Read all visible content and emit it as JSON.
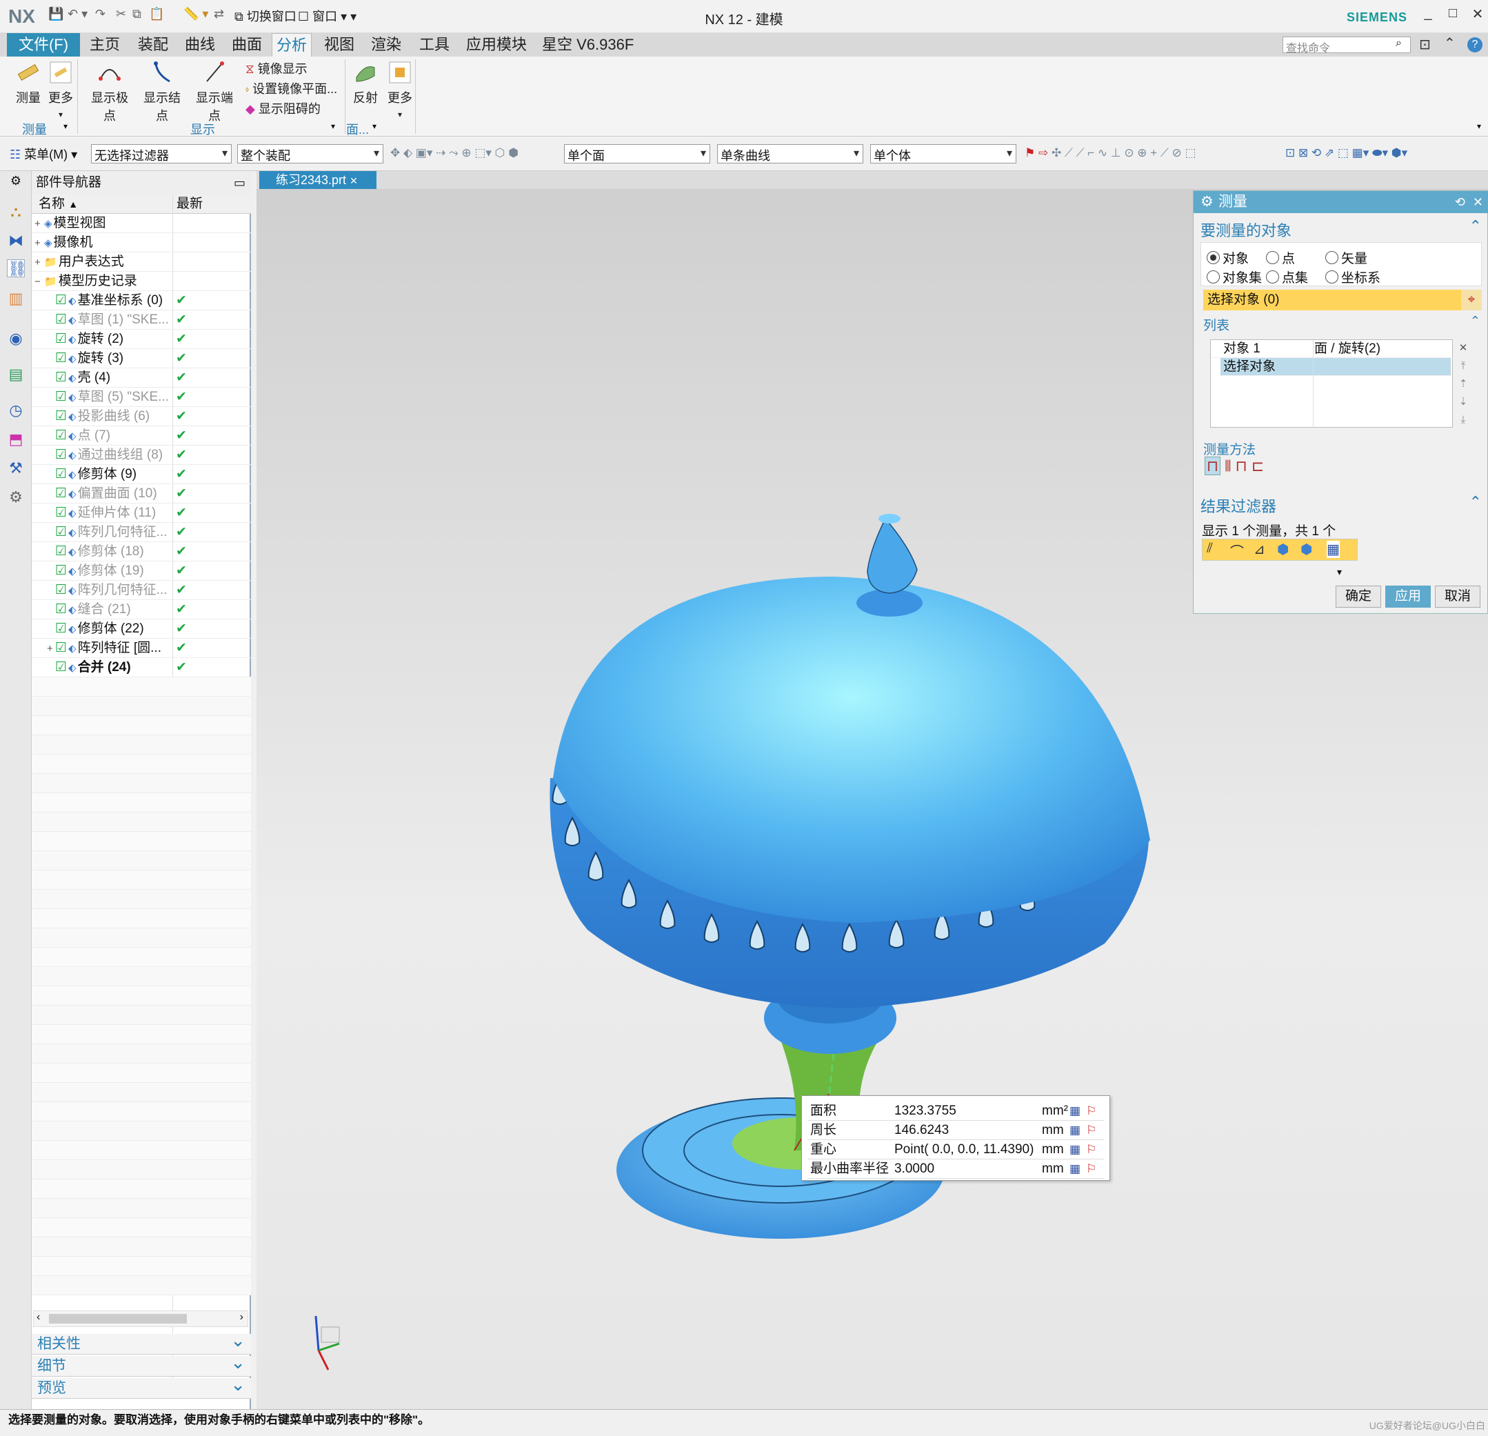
{
  "titlebar": {
    "logo": "NX",
    "switch_window": "切换窗口",
    "window_menu": "窗口",
    "title": "NX 12 - 建模",
    "brand": "SIEMENS",
    "minimize": "_",
    "maximize": "□",
    "close": "✕"
  },
  "menubar": {
    "file": "文件(F)",
    "tabs": [
      "主页",
      "装配",
      "曲线",
      "曲面",
      "分析",
      "视图",
      "渲染",
      "工具",
      "应用模块",
      "星空 V6.936F"
    ],
    "active_tab": "分析",
    "search_placeholder": "查找命令"
  },
  "ribbon": {
    "measure": "测量",
    "more1": "更多",
    "show_poles": "显示极点",
    "show_knots": "显示结点",
    "show_endpoints": "显示端点",
    "mirror_display": "镜像显示",
    "set_mirror_plane": "设置镜像平面...",
    "show_obstruction": "显示阻碍的",
    "reflection": "反射",
    "more2": "更多",
    "group_measure": "测量",
    "group_display": "显示",
    "group_face": "面..."
  },
  "selbar": {
    "menu": "菜单(M)",
    "filter": "无选择过滤器",
    "scope": "整个装配",
    "face_rule": "单个面",
    "curve_rule": "单条曲线",
    "body_rule": "单个体"
  },
  "navigator": {
    "title": "部件导航器",
    "col_name": "名称",
    "col_latest": "最新",
    "items": [
      {
        "label": "模型视图",
        "icon": "model-views-icon",
        "check": ""
      },
      {
        "label": "摄像机",
        "icon": "camera-icon",
        "check": ""
      },
      {
        "label": "用户表达式",
        "icon": "folder-icon",
        "check": ""
      },
      {
        "label": "模型历史记录",
        "icon": "folder-icon",
        "check": ""
      },
      {
        "label": "基准坐标系 (0)",
        "icon": "datum-csys-icon",
        "check": "✔"
      },
      {
        "label": "草图 (1) \"SKE...",
        "icon": "sketch-icon",
        "check": "✔"
      },
      {
        "label": "旋转 (2)",
        "icon": "revolve-icon",
        "check": "✔"
      },
      {
        "label": "旋转 (3)",
        "icon": "revolve-icon",
        "check": "✔"
      },
      {
        "label": "壳 (4)",
        "icon": "shell-icon",
        "check": "✔"
      },
      {
        "label": "草图 (5) \"SKE...",
        "icon": "sketch-icon",
        "check": "✔"
      },
      {
        "label": "投影曲线 (6)",
        "icon": "project-curve-icon",
        "check": "✔"
      },
      {
        "label": "点 (7)",
        "icon": "point-icon",
        "check": "✔"
      },
      {
        "label": "通过曲线组 (8)",
        "icon": "through-curves-icon",
        "check": "✔"
      },
      {
        "label": "修剪体 (9)",
        "icon": "trim-body-icon",
        "check": "✔"
      },
      {
        "label": "偏置曲面 (10)",
        "icon": "offset-surface-icon",
        "check": "✔"
      },
      {
        "label": "延伸片体 (11)",
        "icon": "extend-sheet-icon",
        "check": "✔"
      },
      {
        "label": "阵列几何特征...",
        "icon": "pattern-geometry-icon",
        "check": "✔"
      },
      {
        "label": "修剪体 (18)",
        "icon": "trim-body-icon",
        "check": "✔"
      },
      {
        "label": "修剪体 (19)",
        "icon": "trim-body-icon",
        "check": "✔"
      },
      {
        "label": "阵列几何特征...",
        "icon": "pattern-geometry-icon",
        "check": "✔"
      },
      {
        "label": "缝合 (21)",
        "icon": "sew-icon",
        "check": "✔"
      },
      {
        "label": "修剪体 (22)",
        "icon": "trim-body-icon",
        "check": "✔"
      },
      {
        "label": "阵列特征 [圆...",
        "icon": "pattern-feature-icon",
        "check": "✔"
      },
      {
        "label": "合并 (24)",
        "icon": "unite-icon",
        "check": "✔"
      }
    ],
    "sections": [
      "相关性",
      "细节",
      "预览"
    ]
  },
  "viewport": {
    "file_tab": "练习2343.prt"
  },
  "measure_dialog": {
    "title": "测量",
    "section_objects": "要测量的对象",
    "radios": [
      "对象",
      "点",
      "矢量",
      "对象集",
      "点集",
      "坐标系"
    ],
    "selected_radio": "对象",
    "select_object": "选择对象 (0)",
    "list_label": "列表",
    "list_rows": [
      {
        "name": "对象 1",
        "value": "面 / 旋转(2)"
      },
      {
        "name": "选择对象",
        "value": ""
      }
    ],
    "method_label": "测量方法",
    "result_filter": "结果过滤器",
    "result_count": "显示 1 个测量，共 1 个",
    "ok": "确定",
    "apply": "应用",
    "cancel": "取消"
  },
  "results": [
    {
      "label": "面积",
      "value": "1323.3755",
      "unit": "mm²"
    },
    {
      "label": "周长",
      "value": "146.6243",
      "unit": "mm"
    },
    {
      "label": "重心",
      "value": "Point( 0.0, 0.0, 11.4390)",
      "unit": "mm"
    },
    {
      "label": "最小曲率半径",
      "value": "3.0000",
      "unit": "mm"
    }
  ],
  "status": {
    "message": "选择要测量的对象。要取消选择，使用对象手柄的右键菜单中或列表中的\"移除\"。",
    "watermark": "UG爱好者论坛@UG小白白"
  },
  "colors": {
    "accent": "#2f8fb7",
    "model_blue": "#4aa8ea",
    "highlight_face": "#8fd35a",
    "select_yellow": "#ffd45a"
  }
}
